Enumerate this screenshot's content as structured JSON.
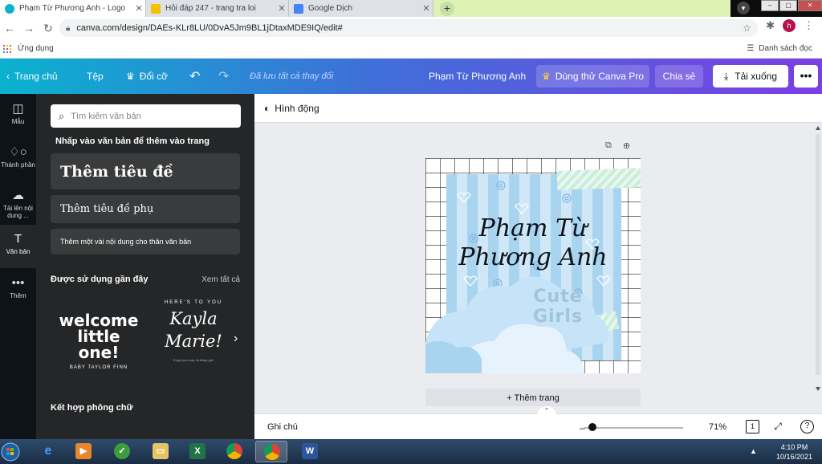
{
  "browser": {
    "tabs": [
      {
        "title": "Phạm Từ Phương Anh - Logo",
        "color": "#0ab2cf",
        "active": true
      },
      {
        "title": "Hỏi đáp 247 - trang tra loi",
        "color": "#f2c200",
        "active": false
      },
      {
        "title": "Google Dịch",
        "color": "#4285f4",
        "active": false
      }
    ],
    "new_tab": "+",
    "url": "canva.com/design/DAEs-KLr8LU/0DvA5Jm9BL1jDtaxMDE9IQ/edit#",
    "avatar_letter": "h",
    "bookmarks": {
      "apps": "Ứng dụng",
      "reading_list": "Danh sách đọc"
    }
  },
  "header": {
    "home": "Trang chủ",
    "file": "Tệp",
    "resize": "Đổi cỡ",
    "saved_status": "Đã lưu tất cả thay đổi",
    "doc_title": "Phạm Từ Phương Anh",
    "try_pro": "Dùng thử Canva Pro",
    "share": "Chia sẻ",
    "download": "Tải xuống",
    "more": "•••"
  },
  "rail": [
    {
      "label": "Mẫu",
      "icon": "template-icon"
    },
    {
      "label": "Thành phần",
      "icon": "elements-icon"
    },
    {
      "label": "Tải lên nội dung ...",
      "icon": "upload-icon"
    },
    {
      "label": "Văn bản",
      "icon": "text-icon"
    },
    {
      "label": "Thêm",
      "icon": "more-icon"
    }
  ],
  "panel": {
    "search_placeholder": "Tìm kiếm văn bản",
    "hint": "Nhấp vào văn bản để thêm vào trang",
    "heading": "Thêm tiêu đề",
    "subheading": "Thêm tiêu đề phụ",
    "body": "Thêm một vài nội dung cho thân văn bản",
    "recent_title": "Được sử dụng gần đây",
    "see_all": "Xem tất cả",
    "recent1_line1": "welcome",
    "recent1_line2": "little one!",
    "recent1_sub": "BABY TAYLOR FINN",
    "recent2_top": "HERE'S TO YOU",
    "recent2_line1": "Kayla",
    "recent2_line2": "Marie!",
    "recent2_tiny": "Enjoy your day, birthday girl!",
    "combo_title": "Kết hợp phông chữ"
  },
  "editor": {
    "animate": "Hình động",
    "design_line1": "Phạm Từ",
    "design_line2": "Phương Anh",
    "design_tag": "Cute Girls",
    "add_page": "+ Thêm trang",
    "notes": "Ghi chú",
    "zoom": "71%",
    "page_count": "1",
    "help": "?"
  },
  "colors": {
    "header_start": "#0ab2cf",
    "header_mid": "#3f6fd8",
    "header_end": "#7b3fe4",
    "panel_bg": "#252627",
    "rail_bg": "#0e1318",
    "design_blue": "#a9d4f0",
    "tape_green": "#c9ecdb"
  },
  "taskbar": {
    "time": "4:10 PM",
    "date": "10/16/2021"
  }
}
